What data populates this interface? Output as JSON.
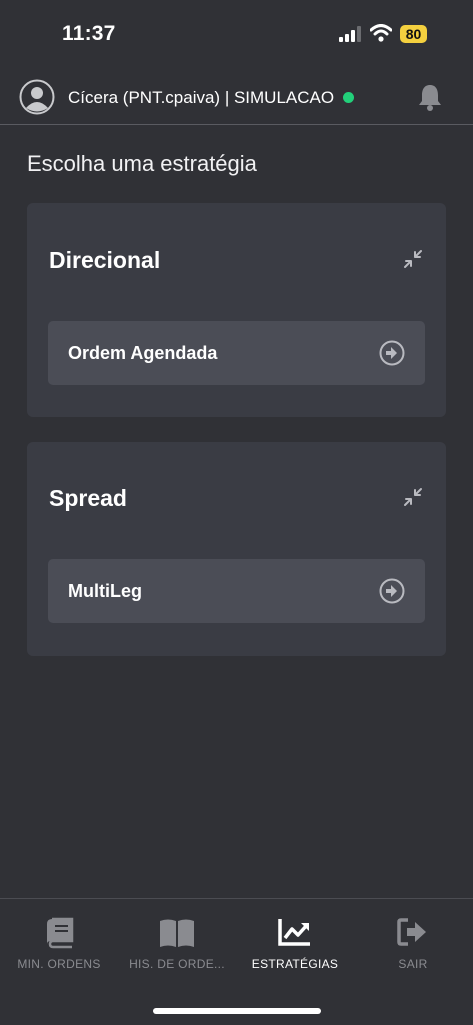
{
  "status_bar": {
    "time": "11:37",
    "battery": "80"
  },
  "header": {
    "user": "Cícera (PNT.cpaiva) | SIMULACAO",
    "status_color": "#22d07a"
  },
  "page": {
    "title": "Escolha uma estratégia"
  },
  "strategies": [
    {
      "title": "Direcional",
      "items": [
        {
          "label": "Ordem Agendada"
        }
      ]
    },
    {
      "title": "Spread",
      "items": [
        {
          "label": "MultiLeg"
        }
      ]
    }
  ],
  "bottom_nav": [
    {
      "label": "MIN. ORDENS",
      "icon": "book-icon",
      "active": false
    },
    {
      "label": "HIS. DE ORDE...",
      "icon": "open-book-icon",
      "active": false
    },
    {
      "label": "ESTRATÉGIAS",
      "icon": "chart-line-icon",
      "active": true
    },
    {
      "label": "SAIR",
      "icon": "sign-out-icon",
      "active": false
    }
  ]
}
